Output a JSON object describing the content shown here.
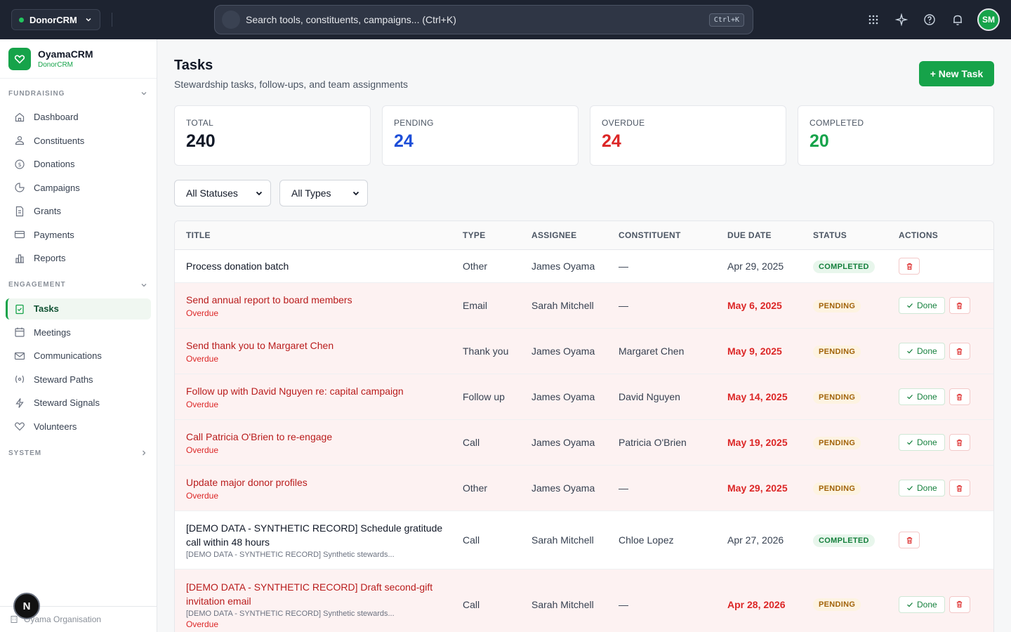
{
  "topbar": {
    "app_switcher": "DonorCRM",
    "search_placeholder": "Search tools, constituents, campaigns... (Ctrl+K)",
    "shortcut": "Ctrl+K",
    "avatar": "SM"
  },
  "sidebar": {
    "brand_name": "OyamaCRM",
    "brand_sub": "DonorCRM",
    "sections": [
      {
        "label": "FUNDRAISING",
        "items": [
          "Dashboard",
          "Constituents",
          "Donations",
          "Campaigns",
          "Grants",
          "Payments",
          "Reports"
        ]
      },
      {
        "label": "ENGAGEMENT",
        "items": [
          "Tasks",
          "Meetings",
          "Communications",
          "Steward Paths",
          "Steward Signals",
          "Volunteers"
        ]
      },
      {
        "label": "SYSTEM",
        "items": []
      }
    ],
    "active": "Tasks",
    "org": "Oyama Organisation",
    "n_badge": "N"
  },
  "page": {
    "title": "Tasks",
    "subtitle": "Stewardship tasks, follow-ups, and team assignments",
    "new_button": "+ New Task"
  },
  "stats": [
    {
      "label": "TOTAL",
      "value": "240",
      "color": "#111827"
    },
    {
      "label": "PENDING",
      "value": "24",
      "color": "#1d4ed8"
    },
    {
      "label": "OVERDUE",
      "value": "24",
      "color": "#dc2626"
    },
    {
      "label": "COMPLETED",
      "value": "20",
      "color": "#16a34a"
    }
  ],
  "filters": {
    "status": "All Statuses",
    "type": "All Types"
  },
  "table": {
    "headers": [
      "TITLE",
      "TYPE",
      "ASSIGNEE",
      "CONSTITUENT",
      "DUE DATE",
      "STATUS",
      "ACTIONS"
    ],
    "done_label": "Done",
    "rows": [
      {
        "title": "Process donation batch",
        "sub": "",
        "overdue_label": "",
        "type": "Other",
        "assignee": "James Oyama",
        "constituent": "—",
        "due": "Apr 29, 2025",
        "status": "COMPLETED"
      },
      {
        "title": "Send annual report to board members",
        "sub": "",
        "overdue_label": "Overdue",
        "type": "Email",
        "assignee": "Sarah Mitchell",
        "constituent": "—",
        "due": "May 6, 2025",
        "status": "PENDING"
      },
      {
        "title": "Send thank you to Margaret Chen",
        "sub": "",
        "overdue_label": "Overdue",
        "type": "Thank you",
        "assignee": "James Oyama",
        "constituent": "Margaret Chen",
        "due": "May 9, 2025",
        "status": "PENDING"
      },
      {
        "title": "Follow up with David Nguyen re: capital campaign",
        "sub": "",
        "overdue_label": "Overdue",
        "type": "Follow up",
        "assignee": "James Oyama",
        "constituent": "David Nguyen",
        "due": "May 14, 2025",
        "status": "PENDING"
      },
      {
        "title": "Call Patricia O'Brien to re-engage",
        "sub": "",
        "overdue_label": "Overdue",
        "type": "Call",
        "assignee": "James Oyama",
        "constituent": "Patricia O'Brien",
        "due": "May 19, 2025",
        "status": "PENDING"
      },
      {
        "title": "Update major donor profiles",
        "sub": "",
        "overdue_label": "Overdue",
        "type": "Other",
        "assignee": "James Oyama",
        "constituent": "—",
        "due": "May 29, 2025",
        "status": "PENDING"
      },
      {
        "title": "[DEMO DATA - SYNTHETIC RECORD] Schedule gratitude call within 48 hours",
        "sub": "[DEMO DATA - SYNTHETIC RECORD] Synthetic stewards...",
        "overdue_label": "",
        "type": "Call",
        "assignee": "Sarah Mitchell",
        "constituent": "Chloe Lopez",
        "due": "Apr 27, 2026",
        "status": "COMPLETED"
      },
      {
        "title": "[DEMO DATA - SYNTHETIC RECORD] Draft second-gift invitation email",
        "sub": "[DEMO DATA - SYNTHETIC RECORD] Synthetic stewards...",
        "overdue_label": "Overdue",
        "type": "Call",
        "assignee": "Sarah Mitchell",
        "constituent": "—",
        "due": "Apr 28, 2026",
        "status": "PENDING"
      }
    ]
  }
}
